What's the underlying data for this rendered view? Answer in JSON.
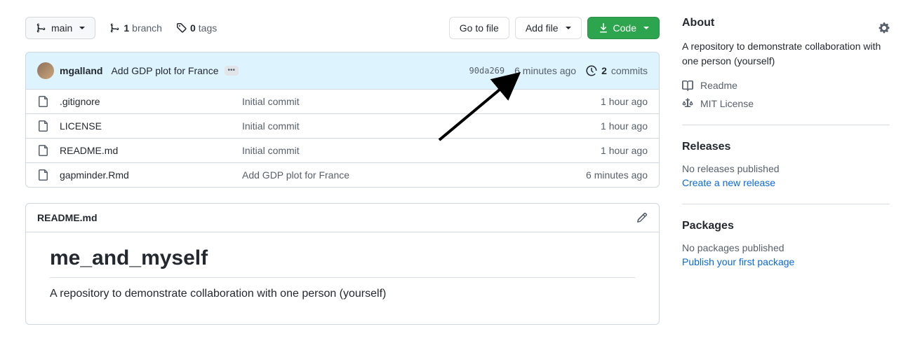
{
  "branch": {
    "current": "main",
    "count": 1,
    "label": "branch"
  },
  "tags": {
    "count": 0,
    "label": "tags"
  },
  "actions": {
    "go_to_file": "Go to file",
    "add_file": "Add file",
    "code": "Code"
  },
  "commit_bar": {
    "author": "mgalland",
    "message": "Add GDP plot for France",
    "sha": "90da269",
    "time": "6 minutes ago",
    "commits_count": 2,
    "commits_label": "commits"
  },
  "files": [
    {
      "name": ".gitignore",
      "commit": "Initial commit",
      "time": "1 hour ago"
    },
    {
      "name": "LICENSE",
      "commit": "Initial commit",
      "time": "1 hour ago"
    },
    {
      "name": "README.md",
      "commit": "Initial commit",
      "time": "1 hour ago"
    },
    {
      "name": "gapminder.Rmd",
      "commit": "Add GDP plot for France",
      "time": "6 minutes ago"
    }
  ],
  "readme": {
    "filename": "README.md",
    "heading": "me_and_myself",
    "body": "A repository to demonstrate collaboration with one person (yourself)"
  },
  "about": {
    "title": "About",
    "description": "A repository to demonstrate collaboration with one person (yourself)",
    "readme_label": "Readme",
    "license_label": "MIT License"
  },
  "releases": {
    "title": "Releases",
    "none": "No releases published",
    "create": "Create a new release"
  },
  "packages": {
    "title": "Packages",
    "none": "No packages published",
    "publish": "Publish your first package"
  }
}
